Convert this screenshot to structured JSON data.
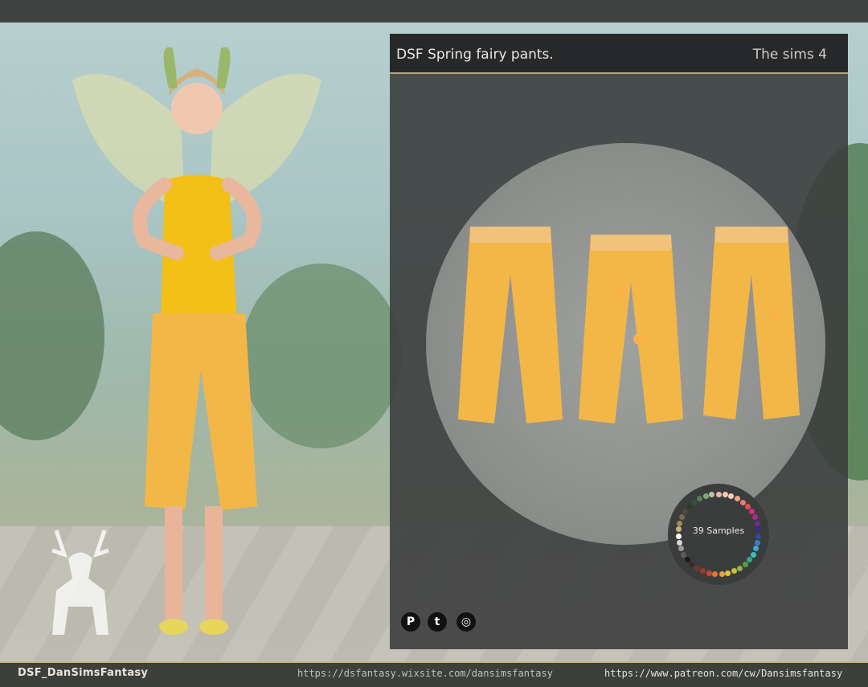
{
  "panel": {
    "title": "DSF Spring fairy pants.",
    "game": "The sims 4",
    "samples": "39 Samples"
  },
  "footer": {
    "brand": "DSF_DanSimsFantasy",
    "link_wix": "https://dsfantasy.wixsite.com/dansimsfantasy",
    "link_patreon": "https://www.patreon.com/cw/Dansimsfantasy"
  },
  "social": [
    "pinterest-icon",
    "tumblr-icon",
    "instagram-icon"
  ],
  "colors": {
    "pants": "#f3b748",
    "outfit_yellow": "#f2c017",
    "panel_bg": "#3c3e3e",
    "accent_gold": "#b9a77a"
  },
  "swatches": [
    "#f3b4b4",
    "#f8c7a7",
    "#f6d0b7",
    "#f2a48a",
    "#ea7b67",
    "#e04e5b",
    "#d12e8a",
    "#a42f8e",
    "#6a2f87",
    "#3d2e83",
    "#2b4a9b",
    "#3a7dc6",
    "#37a8d6",
    "#3fbfbf",
    "#36a884",
    "#4fa33f",
    "#92b53b",
    "#c6c03c",
    "#e3c53c",
    "#e9a53f",
    "#e17a31",
    "#c9472d",
    "#9a3a2e",
    "#6e3a2d",
    "#3d2b25",
    "#1b1b1b",
    "#5d5d5d",
    "#9a9a9a",
    "#d9d9d9",
    "#ffffff",
    "#c8b07a",
    "#a68a5b",
    "#7d6a4c",
    "#4d4a3f",
    "#2e3a2c",
    "#31523e",
    "#5a7a5a",
    "#8ba47a",
    "#b8c79a"
  ]
}
